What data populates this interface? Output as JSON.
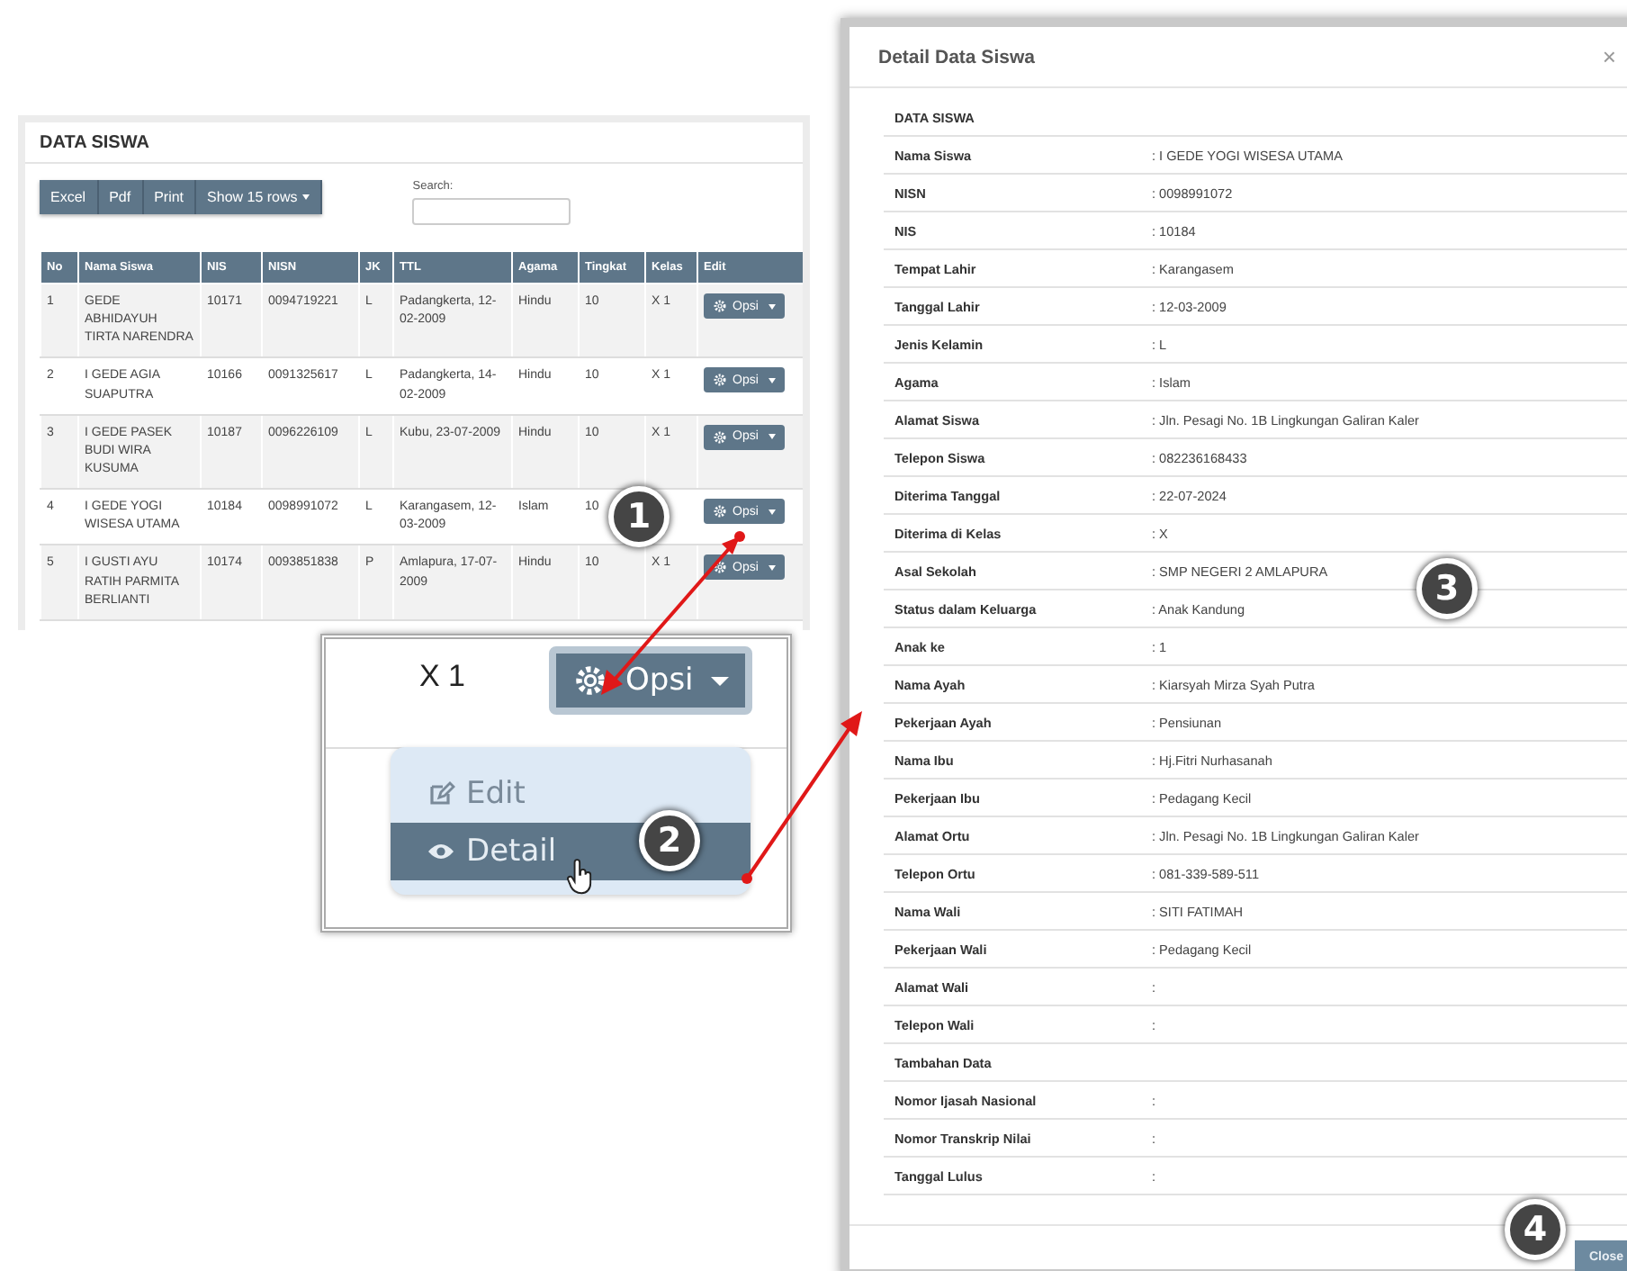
{
  "data_panel": {
    "title": "DATA SISWA",
    "toolbar": [
      "Excel",
      "Pdf",
      "Print",
      "Show 15 rows"
    ],
    "search": {
      "label": "Search:"
    },
    "table": {
      "columns": [
        "No",
        "Nama Siswa",
        "NIS",
        "NISN",
        "JK",
        "TTL",
        "Agama",
        "Tingkat",
        "Kelas",
        "Edit"
      ],
      "rows": [
        {
          "cells": [
            "1",
            "GEDE ABHIDAYUH TIRTA NARENDRA",
            "10171",
            "0094719221",
            "L",
            "Padangkerta, 12-02-2009",
            "Hindu",
            "10",
            "X 1"
          ],
          "action": "Opsi"
        },
        {
          "cells": [
            "2",
            "I GEDE AGIA SUAPUTRA",
            "10166",
            "0091325617",
            "L",
            "Padangkerta, 14-02-2009",
            "Hindu",
            "10",
            "X 1"
          ],
          "action": "Opsi"
        },
        {
          "cells": [
            "3",
            "I GEDE PASEK BUDI WIRA KUSUMA",
            "10187",
            "0096226109",
            "L",
            "Kubu, 23-07-2009",
            "Hindu",
            "10",
            "X 1"
          ],
          "action": "Opsi"
        },
        {
          "cells": [
            "4",
            "I GEDE YOGI WISESA UTAMA",
            "10184",
            "0098991072",
            "L",
            "Karangasem, 12-03-2009",
            "Islam",
            "10",
            ""
          ],
          "action": "Opsi"
        },
        {
          "cells": [
            "5",
            "I GUSTI AYU RATIH PARMITA BERLIANTI",
            "10174",
            "0093851838",
            "P",
            "Amlapura, 17-07-2009",
            "Hindu",
            "10",
            "X 1"
          ],
          "action": "Opsi"
        }
      ]
    }
  },
  "zoom_inset": {
    "kelas": "X 1",
    "button": "Opsi",
    "menu": [
      {
        "label": "Edit",
        "kind": "edit",
        "selected": false
      },
      {
        "label": "Detail",
        "kind": "detail",
        "selected": true
      }
    ]
  },
  "modal": {
    "title": "Detail Data Siswa",
    "close_glyph": "×",
    "fields": [
      {
        "kind": "section",
        "label": "DATA SISWA"
      },
      {
        "kind": "field",
        "label": "Nama Siswa",
        "value": ": I GEDE YOGI WISESA UTAMA"
      },
      {
        "kind": "field",
        "label": "NISN",
        "value": ": 0098991072"
      },
      {
        "kind": "field",
        "label": "NIS",
        "value": ": 10184"
      },
      {
        "kind": "field",
        "label": "Tempat Lahir",
        "value": ": Karangasem"
      },
      {
        "kind": "field",
        "label": "Tanggal Lahir",
        "value": ": 12-03-2009"
      },
      {
        "kind": "field",
        "label": "Jenis Kelamin",
        "value": ": L"
      },
      {
        "kind": "field",
        "label": "Agama",
        "value": ": Islam"
      },
      {
        "kind": "field",
        "label": "Alamat Siswa",
        "value": ": Jln. Pesagi No. 1B Lingkungan Galiran Kaler"
      },
      {
        "kind": "field",
        "label": "Telepon Siswa",
        "value": ": 082236168433"
      },
      {
        "kind": "field",
        "label": "Diterima Tanggal",
        "value": ": 22-07-2024"
      },
      {
        "kind": "field",
        "label": "Diterima di Kelas",
        "value": ": X"
      },
      {
        "kind": "field",
        "label": "Asal Sekolah",
        "value": ": SMP NEGERI 2 AMLAPURA"
      },
      {
        "kind": "field",
        "label": "Status dalam Keluarga",
        "value": ": Anak Kandung"
      },
      {
        "kind": "field",
        "label": "Anak ke",
        "value": ": 1"
      },
      {
        "kind": "field",
        "label": "Nama Ayah",
        "value": ": Kiarsyah Mirza Syah Putra"
      },
      {
        "kind": "field",
        "label": "Pekerjaan Ayah",
        "value": ": Pensiunan"
      },
      {
        "kind": "field",
        "label": "Nama Ibu",
        "value": ": Hj.Fitri Nurhasanah"
      },
      {
        "kind": "field",
        "label": "Pekerjaan Ibu",
        "value": ": Pedagang Kecil"
      },
      {
        "kind": "field",
        "label": "Alamat Ortu",
        "value": ": Jln. Pesagi No. 1B Lingkungan Galiran Kaler"
      },
      {
        "kind": "field",
        "label": "Telepon Ortu",
        "value": ": 081-339-589-511"
      },
      {
        "kind": "field",
        "label": "Nama Wali",
        "value": ": SITI FATIMAH"
      },
      {
        "kind": "field",
        "label": "Pekerjaan Wali",
        "value": ": Pedagang Kecil"
      },
      {
        "kind": "field",
        "label": "Alamat Wali",
        "value": ":"
      },
      {
        "kind": "field",
        "label": "Telepon Wali",
        "value": ":"
      },
      {
        "kind": "section",
        "label": "Tambahan Data"
      },
      {
        "kind": "field",
        "label": "Nomor Ijasah Nasional",
        "value": ":"
      },
      {
        "kind": "field",
        "label": "Nomor Transkrip Nilai",
        "value": ":"
      },
      {
        "kind": "field",
        "label": "Tanggal Lulus",
        "value": ":"
      }
    ],
    "close_button": "Close"
  },
  "step_badges": [
    "1",
    "2",
    "3",
    "4"
  ]
}
